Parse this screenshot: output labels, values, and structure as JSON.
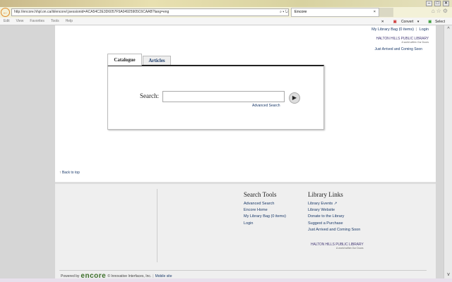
{
  "browser": {
    "url": "http://encore.hhpl.on.ca/iii/encore/;jsessionid=ACA54C2E3D6057F5A04925905C6CAAB?lang=eng",
    "tab_title": "Encore",
    "menu": [
      "Edit",
      "View",
      "Favorites",
      "Tools",
      "Help"
    ],
    "convert_label": "Convert",
    "select_label": "Select"
  },
  "header": {
    "bag_link": "My Library Bag (0 items)",
    "separator": "|",
    "login_link": "Login",
    "logo_text": "HALTON HILLS PUBLIC LIBRARY",
    "logo_tagline": "A world within Our Doors",
    "just_arrived": "Just Arrived and Coming Soon"
  },
  "search": {
    "tabs": [
      {
        "label": "Catalogue",
        "active": true
      },
      {
        "label": "Articles",
        "active": false
      }
    ],
    "label": "Search:",
    "value": "",
    "advanced_link": "Advanced Search"
  },
  "back_to_top": "Back to top",
  "footer": {
    "search_tools": {
      "title": "Search Tools",
      "links": [
        "Advanced Search",
        "Encore Home",
        "My Library Bag (0 items)",
        "Login"
      ]
    },
    "library_links": {
      "title": "Library Links",
      "links": [
        "Library Events",
        "Library Website",
        "Donate to the Library",
        "Suggest a Purchase",
        "Just Arrived and Coming Soon"
      ]
    },
    "logo_text": "HALTON HILLS PUBLIC LIBRARY",
    "logo_tagline": "A world within Our Doors",
    "powered_by": "Powered by",
    "brand": "encore",
    "copyright": "© Innovative Interfaces, Inc.",
    "separator": "|",
    "mobile_link": "Mobile site"
  }
}
